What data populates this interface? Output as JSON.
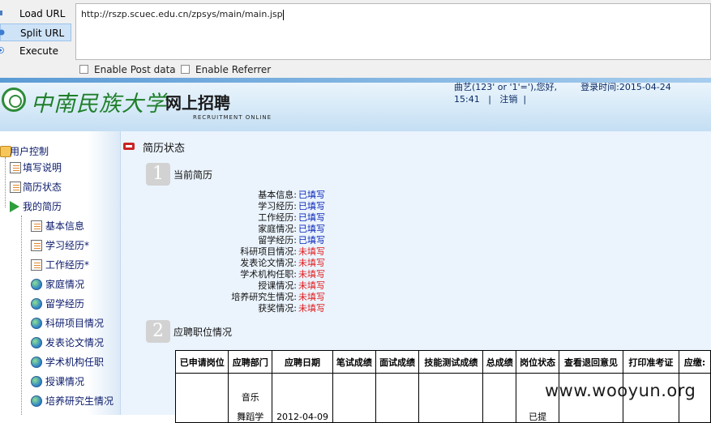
{
  "hackbar": {
    "buttons": [
      {
        "label": "Load URL"
      },
      {
        "label": "Split URL"
      },
      {
        "label": "Execute"
      }
    ],
    "url": "http://rszp.scuec.edu.cn/zpsys/main/main.jsp",
    "enable_post": "Enable Post data",
    "enable_referrer": "Enable Referrer"
  },
  "banner": {
    "university": "中南民族大学",
    "title": "网上招聘",
    "subtitle": "RECRUITMENT ONLINE",
    "greeting": "曲艺(123' or '1'='),您好,",
    "login_time": "登录时间:2015-04-24",
    "login_time_2": "15:41",
    "sep": "|",
    "logout": "注销",
    "sep2": "|"
  },
  "sidebar": {
    "items": [
      {
        "label": "用户控制"
      },
      {
        "label": "填写说明"
      },
      {
        "label": "简历状态"
      },
      {
        "label": "我的简历"
      },
      {
        "label": "基本信息"
      },
      {
        "label": "学习经历*"
      },
      {
        "label": "工作经历*"
      },
      {
        "label": "家庭情况"
      },
      {
        "label": "留学经历"
      },
      {
        "label": "科研项目情况"
      },
      {
        "label": "发表论文情况"
      },
      {
        "label": "学术机构任职"
      },
      {
        "label": "授课情况"
      },
      {
        "label": "培养研究生情况"
      }
    ]
  },
  "main": {
    "title": "简历状态",
    "section1": {
      "num": "1",
      "title": "当前简历"
    },
    "status_rows": [
      {
        "label": "基本信息:",
        "value": "已填写",
        "state": "filled"
      },
      {
        "label": "学习经历:",
        "value": "已填写",
        "state": "filled"
      },
      {
        "label": "工作经历:",
        "value": "已填写",
        "state": "filled"
      },
      {
        "label": "家庭情况:",
        "value": "已填写",
        "state": "filled"
      },
      {
        "label": "留学经历:",
        "value": "已填写",
        "state": "filled"
      },
      {
        "label": "科研项目情况:",
        "value": "未填写",
        "state": "unfilled"
      },
      {
        "label": "发表论文情况:",
        "value": "未填写",
        "state": "unfilled"
      },
      {
        "label": "学术机构任职:",
        "value": "未填写",
        "state": "unfilled"
      },
      {
        "label": "授课情况:",
        "value": "未填写",
        "state": "unfilled"
      },
      {
        "label": "培养研究生情况:",
        "value": "未填写",
        "state": "unfilled"
      },
      {
        "label": "获奖情况:",
        "value": "未填写",
        "state": "unfilled"
      }
    ],
    "section2": {
      "num": "2",
      "title": "应聘职位情况"
    },
    "table": {
      "headers": [
        "已申请岗位",
        "应聘部门",
        "应聘日期",
        "笔试成绩",
        "面试成绩",
        "技能测试成绩",
        "总成绩",
        "岗位状态",
        "查看退回意见",
        "打印准考证",
        "应缴:"
      ],
      "row": [
        "",
        "音乐\n\n舞蹈学",
        "2012-04-09",
        "",
        "",
        "",
        "",
        "已提",
        "",
        "",
        ""
      ]
    }
  },
  "watermark": "www.wooyun.org",
  "colors": {
    "filled": "#0a25b8",
    "unfilled": "#e11a1a",
    "banner_green": "#1f7f2a"
  }
}
